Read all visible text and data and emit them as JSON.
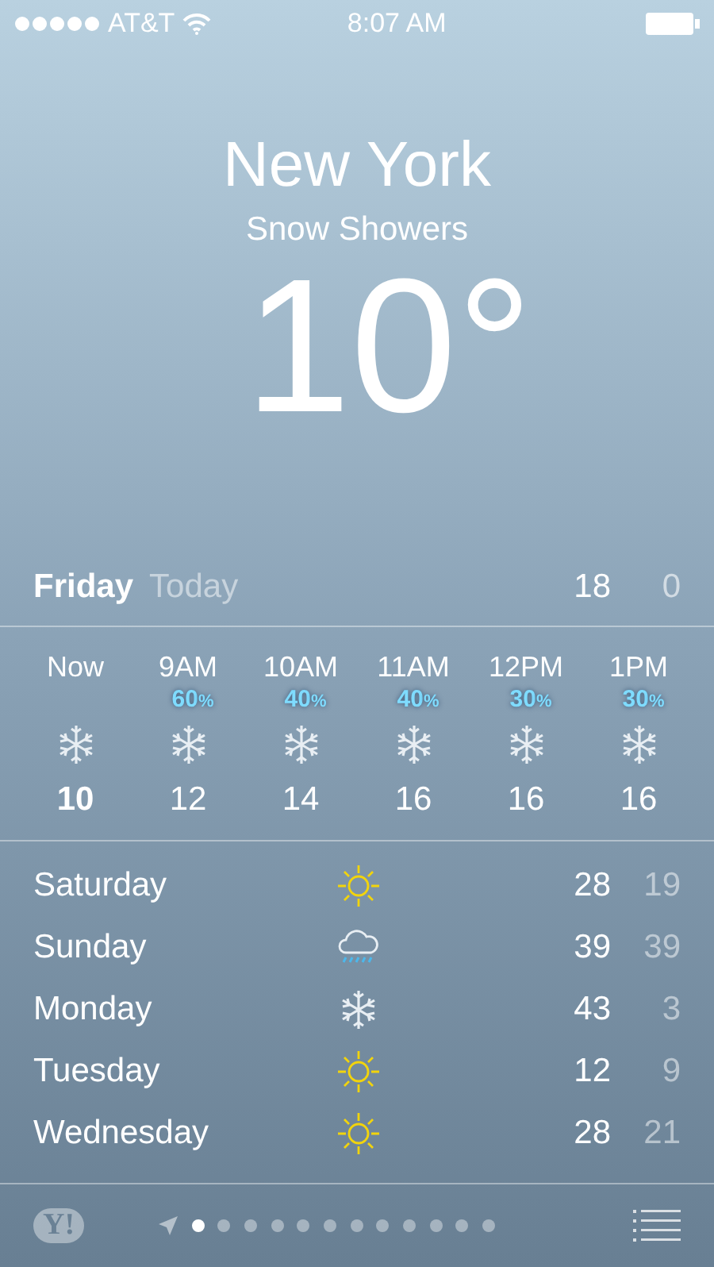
{
  "status_bar": {
    "carrier": "AT&T",
    "time": "8:07 AM"
  },
  "city": "New York",
  "condition": "Snow Showers",
  "temperature": "10°",
  "today": {
    "day": "Friday",
    "label": "Today",
    "high": "18",
    "low": "0"
  },
  "hourly": [
    {
      "time": "Now",
      "kind": "snow",
      "temp": "10",
      "current": true
    },
    {
      "time": "9AM",
      "chance": "60",
      "kind": "snow",
      "temp": "12",
      "current": false
    },
    {
      "time": "10AM",
      "chance": "40",
      "kind": "snow",
      "temp": "14",
      "current": false
    },
    {
      "time": "11AM",
      "chance": "40",
      "kind": "snow",
      "temp": "16",
      "current": false
    },
    {
      "time": "12PM",
      "chance": "30",
      "kind": "snow",
      "temp": "16",
      "current": false
    },
    {
      "time": "1PM",
      "chance": "30",
      "kind": "snow",
      "temp": "16",
      "current": false
    }
  ],
  "percent_sign": "%",
  "daily": [
    {
      "day": "Saturday",
      "kind": "sun",
      "high": "28",
      "low": "19"
    },
    {
      "day": "Sunday",
      "kind": "rain",
      "high": "39",
      "low": "39"
    },
    {
      "day": "Monday",
      "kind": "snow",
      "high": "43",
      "low": "3"
    },
    {
      "day": "Tuesday",
      "kind": "sun",
      "high": "12",
      "low": "9"
    },
    {
      "day": "Wednesday",
      "kind": "sun",
      "high": "28",
      "low": "21"
    }
  ],
  "footer": {
    "logo": "Y!",
    "pages": [
      {
        "selected": true
      },
      {
        "selected": false
      },
      {
        "selected": false
      },
      {
        "selected": false
      },
      {
        "selected": false
      },
      {
        "selected": false
      },
      {
        "selected": false
      },
      {
        "selected": false
      },
      {
        "selected": false
      },
      {
        "selected": false
      },
      {
        "selected": false
      },
      {
        "selected": false
      }
    ]
  }
}
